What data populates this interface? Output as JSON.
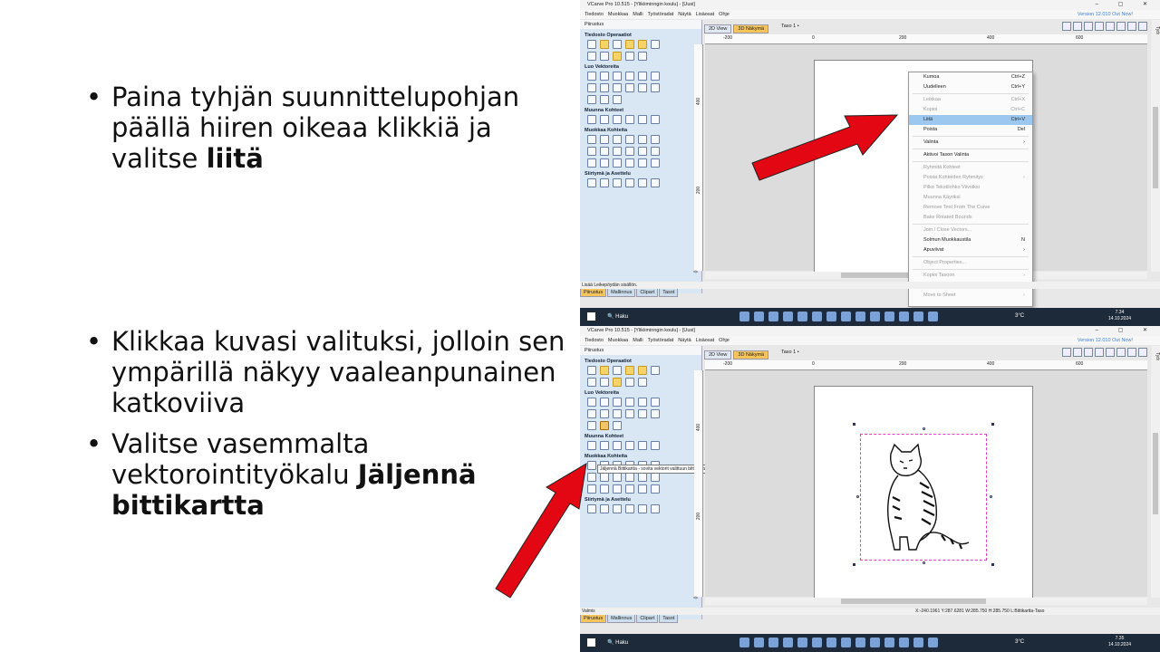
{
  "bullets_top": [
    {
      "text": "Paina tyhjän suunnittelupohjan päällä hiiren oikeaa klikkiä ja valitse ",
      "bold": "liitä"
    }
  ],
  "bullets_bottom": [
    {
      "text": "Klikkaa kuvasi valituksi, jolloin sen ympärillä näkyy vaaleanpunainen katkoviiva",
      "bold": ""
    },
    {
      "text": "Valitse vasemmalta vektorointityökalu ",
      "bold": "Jäljennä bittikartta"
    }
  ],
  "app": {
    "title": "VCarve Pro 10.515 - [Ylikiiminngin koulu] - [Uusi]",
    "menu": [
      "Tiedosto",
      "Muokkaa",
      "Malli",
      "Työstöradat",
      "Näytä",
      "Lisäosat",
      "Ohje"
    ],
    "version_link": "Version 12.010 Out Now!",
    "panel_title": "Piirustus",
    "sections": [
      "Tiedosto Operaatiot",
      "Luo Vektoreita",
      "Muunna Kohteet",
      "Muokkaa Kohteita",
      "Siirtymä ja Asettelu"
    ],
    "view_tabs": [
      "2D View",
      "3D Näkymä"
    ],
    "layer": "Taso 1 •",
    "bottom_tabs": [
      "Piirustus",
      "Mallinnus",
      "Clipart",
      "Tasot"
    ],
    "side_tab": "Työstöradat",
    "ruler_h": [
      "-200",
      "0",
      "200",
      "400",
      "600"
    ],
    "ruler_v": [
      "400",
      "200",
      "0"
    ]
  },
  "shot1": {
    "status": "Lisää Leikepöydän sisällön.",
    "context_menu": [
      {
        "label": "Kumoa",
        "shortcut": "Ctrl+Z",
        "state": "normal"
      },
      {
        "label": "Uudelleen",
        "shortcut": "Ctrl+Y",
        "state": "normal"
      },
      {
        "sep": true
      },
      {
        "label": "Leikkaa",
        "shortcut": "Ctrl+X",
        "state": "disabled"
      },
      {
        "label": "Kopioi",
        "shortcut": "Ctrl+C",
        "state": "disabled"
      },
      {
        "label": "Liitä",
        "shortcut": "Ctrl+V",
        "state": "highlight"
      },
      {
        "label": "Poista",
        "shortcut": "Del",
        "state": "normal"
      },
      {
        "sep": true
      },
      {
        "label": "Valinta",
        "shortcut": "›",
        "state": "normal"
      },
      {
        "sep": true
      },
      {
        "label": "Aktivoi Tason Valinta",
        "shortcut": "",
        "state": "normal"
      },
      {
        "sep": true
      },
      {
        "label": "Ryhmitä Kohteet",
        "shortcut": "",
        "state": "disabled"
      },
      {
        "label": "Poista Kohteiden Ryhmitys",
        "shortcut": "›",
        "state": "disabled"
      },
      {
        "label": "Pilko Tekstilohko Viivoiksi",
        "shortcut": "",
        "state": "disabled"
      },
      {
        "label": "Muunna Käyriksi",
        "shortcut": "",
        "state": "disabled"
      },
      {
        "label": "Remove Text From The Curve",
        "shortcut": "",
        "state": "disabled"
      },
      {
        "label": "Bake Rotated Bounds",
        "shortcut": "",
        "state": "disabled"
      },
      {
        "sep": true
      },
      {
        "label": "Join / Close Vectors...",
        "shortcut": "",
        "state": "disabled"
      },
      {
        "label": "Solmun Muokkaustila",
        "shortcut": "N",
        "state": "normal"
      },
      {
        "label": "Apuviivat",
        "shortcut": "›",
        "state": "normal"
      },
      {
        "sep": true
      },
      {
        "label": "Object Properties...",
        "shortcut": "",
        "state": "disabled"
      },
      {
        "sep": true
      },
      {
        "label": "Kopioi Tasoon",
        "shortcut": "›",
        "state": "disabled"
      },
      {
        "label": "Siirrä Tasoon",
        "shortcut": "›",
        "state": "disabled"
      },
      {
        "label": "Move to Sheet",
        "shortcut": "›",
        "state": "disabled"
      }
    ],
    "clock": {
      "time": "7.34",
      "date": "14.10.2024"
    }
  },
  "shot2": {
    "status": "Valmis",
    "coords": "X:-240.1961 Y:287.6281",
    "size": "W:285.750  H:285.750  L:Bittikartta-Taso",
    "tooltip": "Jäljennä Bittikartta - sovita vektorit valittuun bittikarttaan",
    "clock": {
      "time": "7.35",
      "date": "14.10.2024"
    }
  },
  "taskbar": {
    "search": "Haku",
    "weather": "3°C"
  },
  "colors": {
    "arrow": "#e30613",
    "accent": "#f6c45a",
    "selection": "#e040c0"
  }
}
